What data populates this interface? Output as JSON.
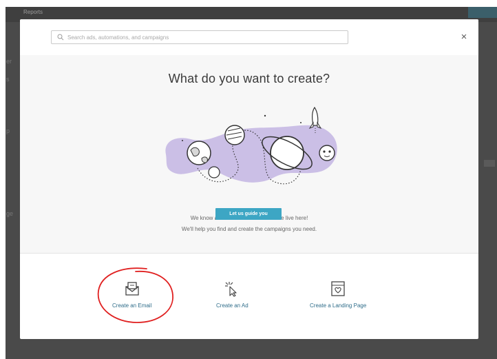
{
  "background": {
    "header_text": "Reports",
    "left_fragments": [
      "er",
      "s",
      "p",
      "ge"
    ]
  },
  "modal": {
    "search": {
      "placeholder": "Search ads, automations, and campaigns"
    },
    "close_label": "×",
    "title": "What do you want to create?",
    "description_line1": "We know all the shortcuts because we live here!",
    "description_line2": "We'll help you find and create the campaigns you need.",
    "guide_button": "Let us guide you",
    "options": [
      {
        "label": "Create an Email",
        "icon": "email-icon"
      },
      {
        "label": "Create an Ad",
        "icon": "cursor-click-icon"
      },
      {
        "label": "Create a Landing Page",
        "icon": "landing-page-icon"
      }
    ]
  },
  "colors": {
    "accent": "#3da6c4",
    "link": "#2f6d8a",
    "illustration_blob": "#cbbfe6",
    "annotation": "#e02020"
  }
}
